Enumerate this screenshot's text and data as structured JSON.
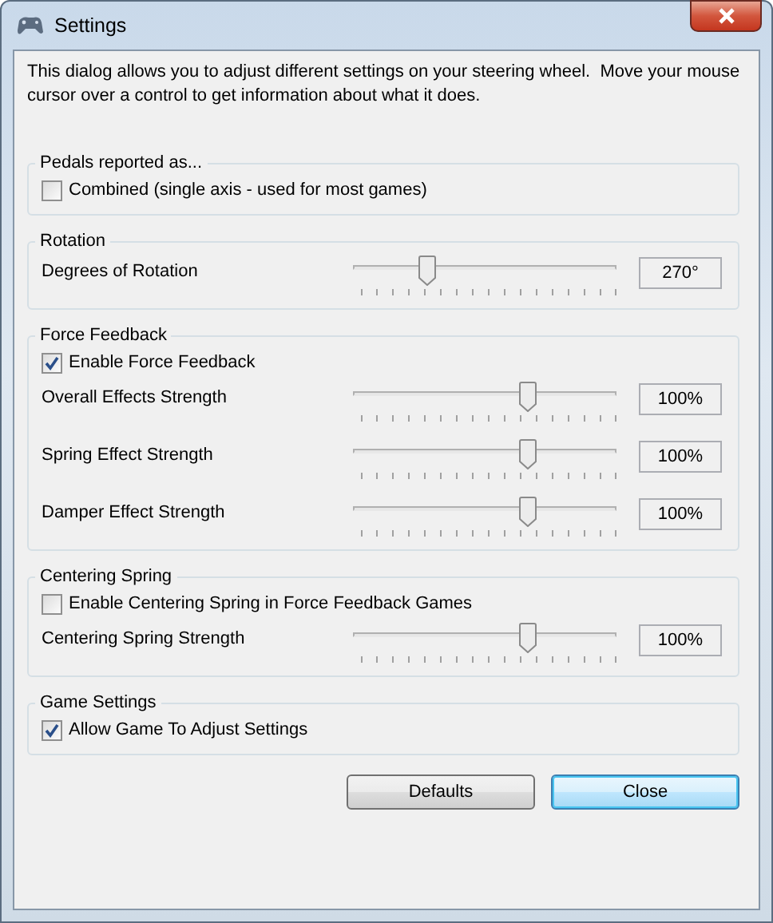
{
  "window": {
    "title": "Settings"
  },
  "description": "This dialog allows you to adjust different settings on your steering wheel.  Move your mouse cursor over a control to get information about what it does.",
  "groups": [
    {
      "title": "Pedals reported as...",
      "items": [
        {
          "kind": "checkbox",
          "label": "Combined (single axis - used for most games)",
          "checked": false
        }
      ]
    },
    {
      "title": "Rotation",
      "items": [
        {
          "kind": "slider",
          "label": "Degrees of Rotation",
          "level": 0.28,
          "reading": "270°"
        }
      ]
    },
    {
      "title": "Force Feedback",
      "items": [
        {
          "kind": "checkbox",
          "label": "Enable Force Feedback",
          "checked": true
        },
        {
          "kind": "slider",
          "label": "Overall Effects Strength",
          "level": 0.66,
          "reading": "100%"
        },
        {
          "kind": "slider",
          "label": "Spring Effect Strength",
          "level": 0.66,
          "reading": "100%"
        },
        {
          "kind": "slider",
          "label": "Damper Effect Strength",
          "level": 0.66,
          "reading": "100%"
        }
      ]
    },
    {
      "title": "Centering Spring",
      "items": [
        {
          "kind": "checkbox",
          "label": "Enable Centering Spring in Force Feedback Games",
          "checked": false
        },
        {
          "kind": "slider",
          "label": "Centering Spring Strength",
          "level": 0.66,
          "reading": "100%"
        }
      ]
    },
    {
      "title": "Game Settings",
      "items": [
        {
          "kind": "checkbox",
          "label": "Allow Game To Adjust Settings",
          "checked": true
        }
      ]
    }
  ],
  "buttons": [
    {
      "label": "Defaults",
      "default": false
    },
    {
      "label": "Close",
      "default": true
    }
  ]
}
